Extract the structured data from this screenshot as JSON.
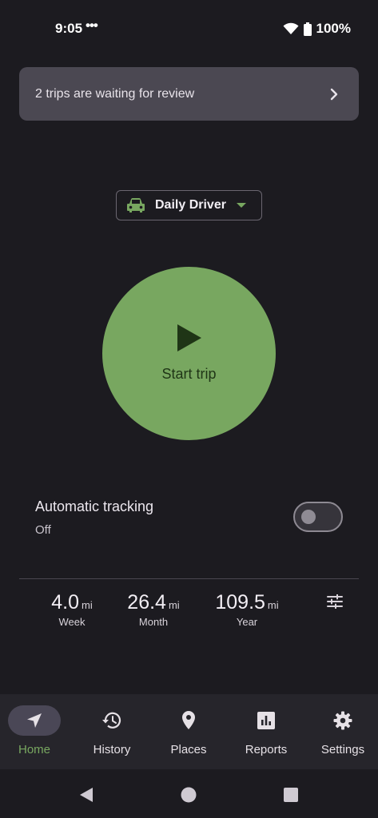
{
  "status_bar": {
    "time": "9:05",
    "dots": "•••",
    "battery": "100%"
  },
  "banner": {
    "text": "2 trips are waiting for review"
  },
  "vehicle": {
    "name": "Daily Driver"
  },
  "start": {
    "label": "Start trip"
  },
  "auto_tracking": {
    "title": "Automatic tracking",
    "status": "Off",
    "enabled": false
  },
  "stats": [
    {
      "value": "4.0",
      "unit": "mi",
      "label": "Week"
    },
    {
      "value": "26.4",
      "unit": "mi",
      "label": "Month"
    },
    {
      "value": "109.5",
      "unit": "mi",
      "label": "Year"
    }
  ],
  "nav": [
    {
      "label": "Home",
      "icon": "navigation-icon",
      "active": true
    },
    {
      "label": "History",
      "icon": "history-icon"
    },
    {
      "label": "Places",
      "icon": "location-pin-icon"
    },
    {
      "label": "Reports",
      "icon": "bar-chart-icon"
    },
    {
      "label": "Settings",
      "icon": "gear-icon"
    }
  ],
  "colors": {
    "accent": "#78a760",
    "background": "#1c1b20",
    "banner": "#4b4852"
  }
}
